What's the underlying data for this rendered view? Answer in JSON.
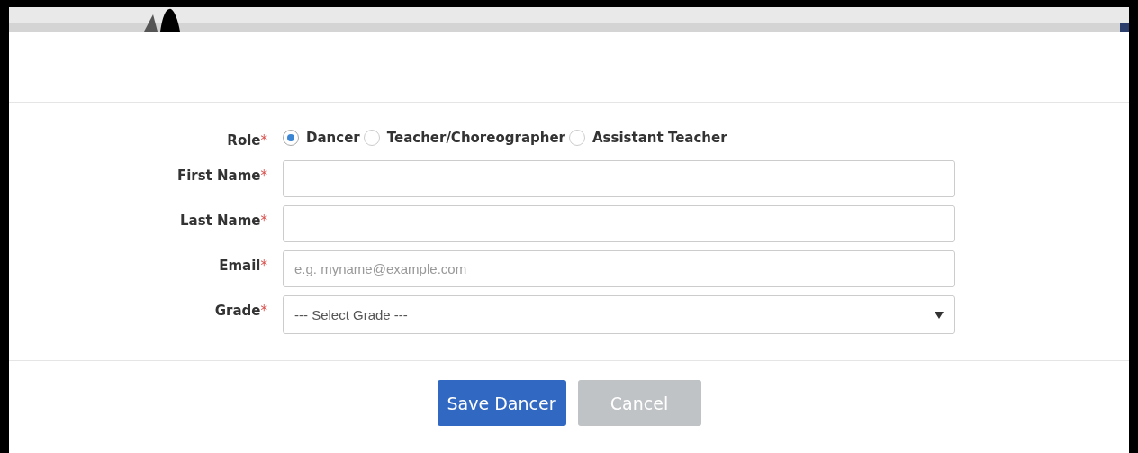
{
  "form": {
    "fields": [
      {
        "kind": "radio",
        "label": "Role",
        "required": true,
        "options": [
          {
            "label": "Dancer",
            "selected": true
          },
          {
            "label": "Teacher/Choreographer",
            "selected": false
          },
          {
            "label": "Assistant Teacher",
            "selected": false
          }
        ]
      },
      {
        "kind": "text",
        "label": "First Name",
        "required": true
      },
      {
        "kind": "text",
        "label": "Last Name",
        "required": true
      },
      {
        "kind": "text",
        "label": "Email",
        "required": true,
        "placeholder": "e.g. myname@example.com"
      },
      {
        "kind": "select",
        "label": "Grade",
        "required": true,
        "value": "--- Select Grade ---"
      }
    ]
  },
  "buttons": [
    {
      "label": "Save Dancer",
      "kind": "primary",
      "disabled": false
    },
    {
      "label": "Cancel",
      "kind": "secondary",
      "disabled": true
    }
  ],
  "required_mark": "*"
}
